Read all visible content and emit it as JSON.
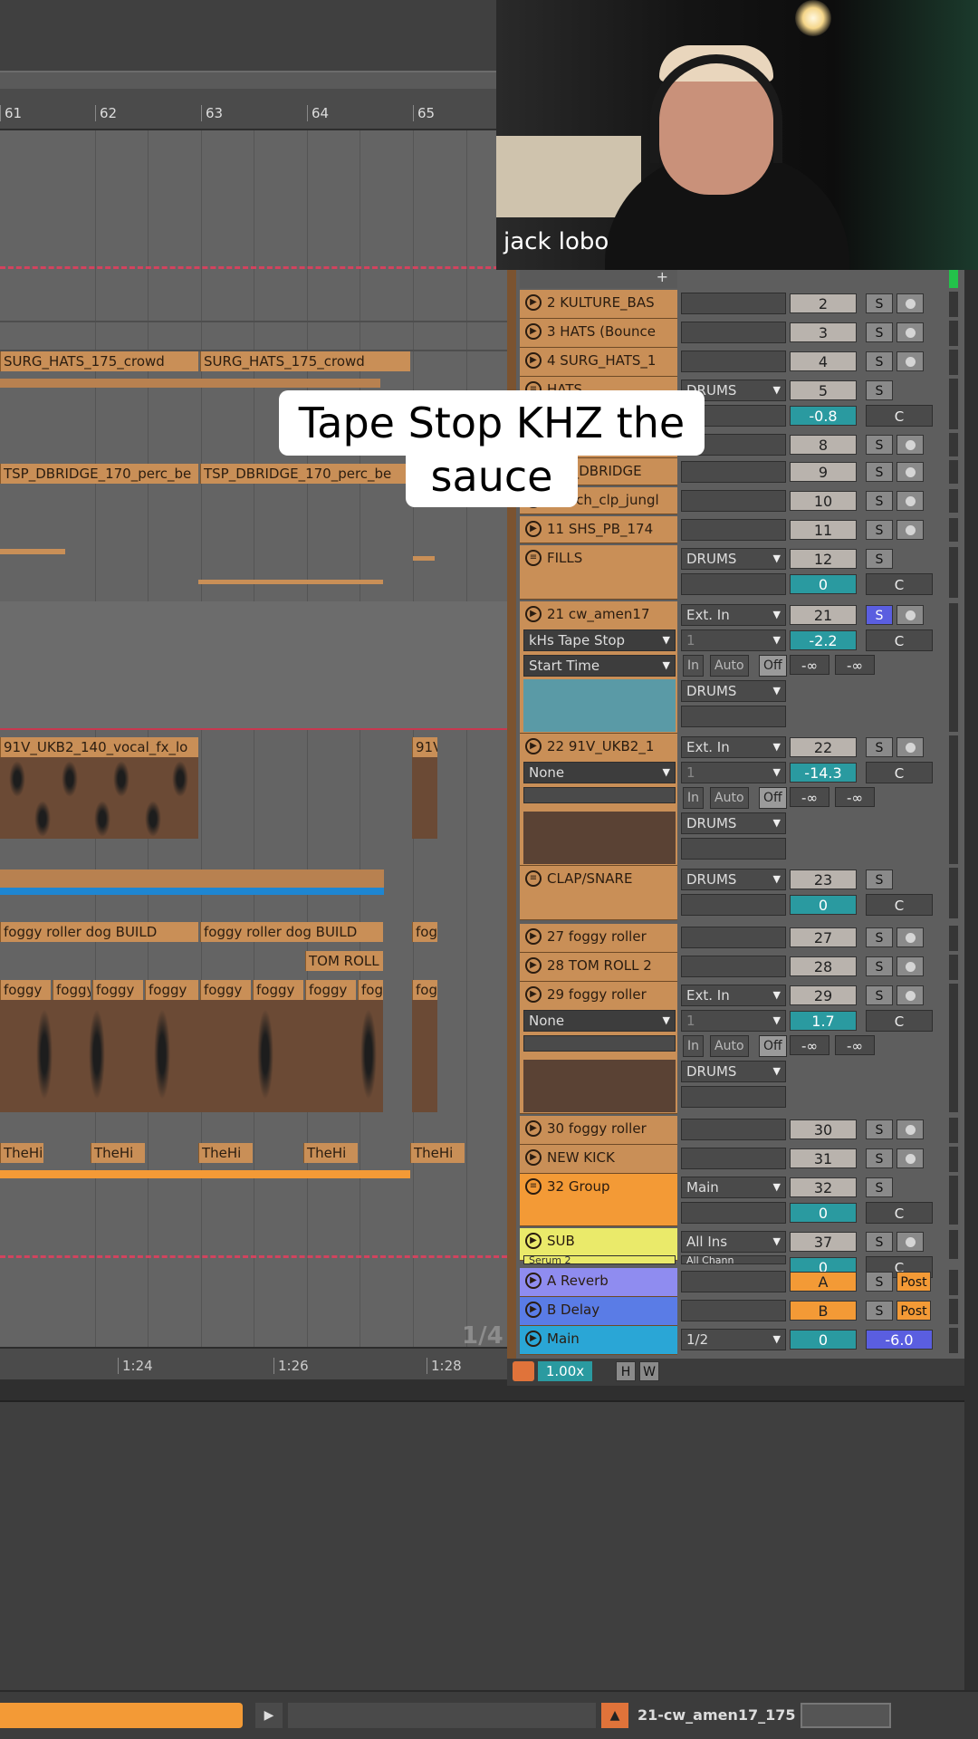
{
  "ruler": {
    "marks": [
      "61",
      "62",
      "63",
      "64",
      "65"
    ]
  },
  "timeline": {
    "marks": [
      "1:24",
      "1:26",
      "1:28"
    ],
    "page_indicator": "1/4"
  },
  "caption": {
    "line1": "Tape Stop KHZ the",
    "line2": "sauce"
  },
  "webcam": {
    "name": "jack lobo"
  },
  "clips": {
    "surg_hats": "SURG_HATS_175_crowd",
    "tsp_dbridge": "TSP_DBRIDGE_170_perc_be",
    "vocal_fx": "91V_UKB2_140_vocal_fx_lo",
    "vocal_fx_short": "91V",
    "foggy_build": "foggy roller dog BUILD",
    "foggy_short": "fog",
    "tom_roll": "TOM ROLL",
    "foggy": "foggy",
    "thehi": "TheHi"
  },
  "mixer": {
    "plus": "+",
    "tracks": [
      {
        "name": "2 KULTURE_BAS",
        "num": "2"
      },
      {
        "name": "3 HATS (Bounce",
        "num": "3"
      },
      {
        "name": "4 SURG_HATS_1",
        "num": "4"
      },
      {
        "name": "HATS",
        "num": "5",
        "route": "DRUMS",
        "vol": "-0.8",
        "c": "C"
      },
      {
        "name": "",
        "num": "8"
      },
      {
        "name": "TSP_DBRIDGE",
        "num": "9"
      },
      {
        "name": "10 cch_clp_jungl",
        "num": "10"
      },
      {
        "name": "11 SHS_PB_174",
        "num": "11"
      },
      {
        "name": "FILLS",
        "num": "12",
        "route": "DRUMS",
        "vol": "0",
        "c": "C"
      },
      {
        "name": "21 cw_amen17",
        "num": "21",
        "route": "Ext. In",
        "device": "kHs Tape Stop",
        "param": "Start Time",
        "input": "1",
        "vol": "-2.2",
        "c": "C",
        "in": "In",
        "auto": "Auto",
        "off": "Off",
        "inf1": "-∞",
        "inf2": "-∞",
        "out": "DRUMS"
      },
      {
        "name": "22 91V_UKB2_1",
        "num": "22",
        "route": "Ext. In",
        "device": "None",
        "input": "1",
        "vol": "-14.3",
        "c": "C",
        "in": "In",
        "auto": "Auto",
        "off": "Off",
        "inf1": "-∞",
        "inf2": "-∞",
        "out": "DRUMS"
      },
      {
        "name": "CLAP/SNARE",
        "num": "23",
        "route": "DRUMS",
        "vol": "0",
        "c": "C"
      },
      {
        "name": "27 foggy roller",
        "num": "27"
      },
      {
        "name": "28 TOM ROLL 2",
        "num": "28"
      },
      {
        "name": "29 foggy roller",
        "num": "29",
        "route": "Ext. In",
        "device": "None",
        "input": "1",
        "vol": "1.7",
        "c": "C",
        "in": "In",
        "auto": "Auto",
        "off": "Off",
        "inf1": "-∞",
        "inf2": "-∞",
        "out": "DRUMS"
      },
      {
        "name": "30 foggy roller",
        "num": "30"
      },
      {
        "name": "NEW KICK",
        "num": "31"
      },
      {
        "name": "32 Group",
        "num": "32",
        "route": "Main",
        "vol": "0",
        "c": "C"
      },
      {
        "name": "SUB",
        "num": "37",
        "route": "All Ins",
        "sub": "Serum 2",
        "sub2": "All Chann",
        "vol": "0",
        "c": "C"
      },
      {
        "name": "A Reverb",
        "num": "A",
        "post": "Post"
      },
      {
        "name": "B Delay",
        "num": "B",
        "post": "Post"
      },
      {
        "name": "Main",
        "route": "1/2",
        "num": "0",
        "vol": "-6.0"
      }
    ],
    "s": "S",
    "zoom": "1.00x",
    "h": "H",
    "w": "W"
  },
  "bottom": {
    "clip_name": "21-cw_amen17_175"
  }
}
